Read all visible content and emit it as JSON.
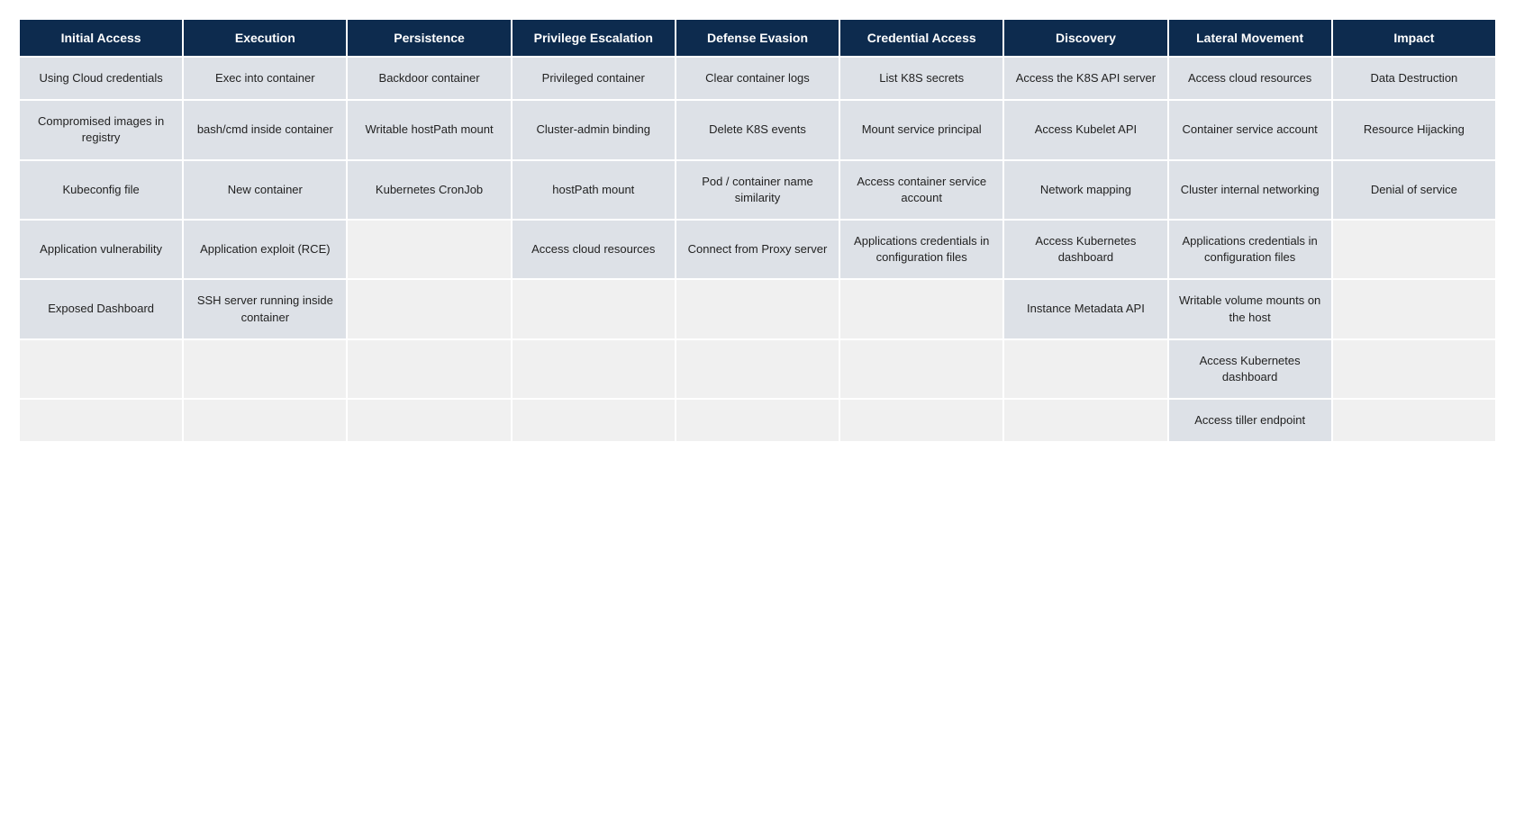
{
  "table": {
    "headers": [
      "Initial Access",
      "Execution",
      "Persistence",
      "Privilege Escalation",
      "Defense Evasion",
      "Credential Access",
      "Discovery",
      "Lateral Movement",
      "Impact"
    ],
    "rows": [
      [
        "Using Cloud credentials",
        "Exec into container",
        "Backdoor container",
        "Privileged container",
        "Clear container logs",
        "List K8S secrets",
        "Access the K8S API server",
        "Access cloud resources",
        "Data Destruction"
      ],
      [
        "Compromised images in registry",
        "bash/cmd inside container",
        "Writable hostPath mount",
        "Cluster-admin binding",
        "Delete K8S events",
        "Mount service principal",
        "Access Kubelet API",
        "Container service account",
        "Resource Hijacking"
      ],
      [
        "Kubeconfig file",
        "New container",
        "Kubernetes CronJob",
        "hostPath mount",
        "Pod / container name similarity",
        "Access container service account",
        "Network mapping",
        "Cluster internal networking",
        "Denial of service"
      ],
      [
        "Application vulnerability",
        "Application exploit (RCE)",
        "",
        "Access cloud resources",
        "Connect from Proxy server",
        "Applications credentials in configuration files",
        "Access Kubernetes dashboard",
        "Applications credentials in configuration files",
        ""
      ],
      [
        "Exposed Dashboard",
        "SSH server running inside container",
        "",
        "",
        "",
        "",
        "Instance Metadata API",
        "Writable volume mounts on the host",
        ""
      ],
      [
        "",
        "",
        "",
        "",
        "",
        "",
        "",
        "Access Kubernetes dashboard",
        ""
      ],
      [
        "",
        "",
        "",
        "",
        "",
        "",
        "",
        "Access tiller endpoint",
        ""
      ]
    ]
  }
}
